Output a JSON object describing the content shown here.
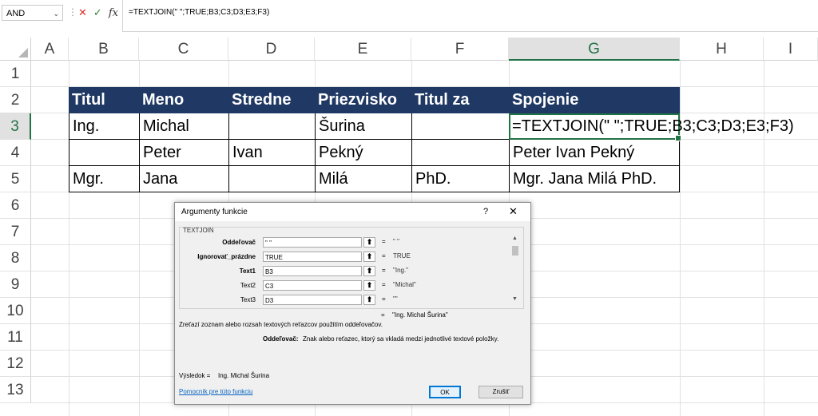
{
  "formula_bar": {
    "name_box": "AND",
    "cancel_glyph": "✕",
    "enter_glyph": "✓",
    "fx_label": "fx",
    "formula": "=TEXTJOIN(\" \";TRUE;B3;C3;D3;E3;F3)"
  },
  "columns": [
    "A",
    "B",
    "C",
    "D",
    "E",
    "F",
    "G",
    "H",
    "I"
  ],
  "rows": [
    "1",
    "2",
    "3",
    "4",
    "5",
    "6",
    "7",
    "8",
    "9",
    "10",
    "11",
    "12",
    "13"
  ],
  "table": {
    "header": [
      "Titul",
      "Meno",
      "Stredne",
      "Priezvisko",
      "Titul za",
      "Spojenie"
    ],
    "rows": [
      [
        "Ing.",
        "Michal",
        "",
        "Šurina",
        "",
        "=TEXTJOIN(\" \";TRUE;B3;C3;D3;E3;F3)"
      ],
      [
        "",
        "Peter",
        "Ivan",
        "Pekný",
        "",
        "Peter Ivan Pekný"
      ],
      [
        "Mgr.",
        "Jana",
        "",
        "Milá",
        "PhD.",
        "Mgr. Jana Milá PhD."
      ]
    ]
  },
  "dialog": {
    "title": "Argumenty funkcie",
    "help": "?",
    "close": "✕",
    "group_label": "TEXTJOIN",
    "args": [
      {
        "label": "Oddeľovač",
        "value": "\" \"",
        "result": "\" \""
      },
      {
        "label": "Ignorovať_prázdne",
        "value": "TRUE",
        "result": "TRUE"
      },
      {
        "label": "Text1",
        "value": "B3",
        "result": "\"Ing.\""
      },
      {
        "label": "Text2",
        "value": "C3",
        "result": "\"Michal\""
      },
      {
        "label": "Text3",
        "value": "D3",
        "result": "\"\""
      }
    ],
    "equals": "=",
    "function_result": "\"Ing. Michal Šurina\"",
    "description": "Zreťazí zoznam alebo rozsah textových reťazcov použitím oddeľovačov.",
    "param_name": "Oddeľovač:",
    "param_description": "Znak alebo reťazec, ktorý sa vkladá medzi jednotlivé textové položky.",
    "result_label": "Výsledok =",
    "result_value": "Ing. Michal Šurina",
    "help_link": "Pomocník pre túto funkciu",
    "ok": "OK",
    "cancel": "Zrušiť"
  }
}
